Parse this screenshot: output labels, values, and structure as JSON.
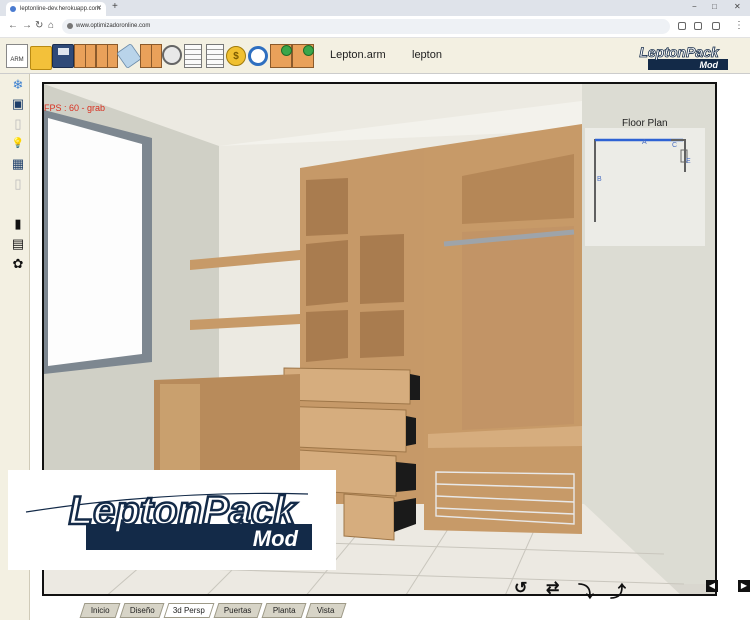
{
  "browser": {
    "tab_title": "leptonline-dev.herokuapp.com",
    "new_tab": "+",
    "url": "www.optimizadoronline.com",
    "win_minimize": "−",
    "win_maximize": "□",
    "win_close": "✕"
  },
  "toolbar": {
    "arm_label": "Lepton.arm",
    "user_label": "lepton",
    "new_doc_text": "ARM",
    "coin_text": "$",
    "icons": [
      "arm-doc-icon",
      "open-folder-icon",
      "save-disk-icon",
      "cabinet-icon",
      "cabinet-door-icon",
      "eraser-icon",
      "rotate-view-icon",
      "cabinet-frame-icon",
      "report-icon",
      "list-icon",
      "price-coin-icon",
      "refresh-icon",
      "cabinet-settings-icon",
      "cabinet-green-icon"
    ]
  },
  "logo": {
    "line1": "LeptonPack",
    "line2": "Mod"
  },
  "sidebar": {
    "items": [
      {
        "name": "3d-cube-icon",
        "glyph": "❄"
      },
      {
        "name": "hd-screen-icon",
        "glyph": "▣"
      },
      {
        "name": "fridge-icon",
        "glyph": "▯"
      },
      {
        "name": "lightbulb-icon",
        "glyph": "💡"
      },
      {
        "name": "window-icon",
        "glyph": "▦"
      },
      {
        "name": "door-light-icon",
        "glyph": "▯"
      },
      {
        "name": "door-dark-icon",
        "glyph": "▮"
      },
      {
        "name": "film-icon",
        "glyph": "▤"
      },
      {
        "name": "plant-icon",
        "glyph": "✿"
      }
    ]
  },
  "viewport": {
    "fps_text": "FPS : 60 - grab",
    "floor_plan_title": "Floor Plan",
    "floor_plan_labels": {
      "a": "A",
      "b": "B",
      "c": "C",
      "e": "E"
    }
  },
  "view_controls": {
    "undo": "↺",
    "swap": "⇄",
    "down": "⤵",
    "up": "⤴",
    "prev": "◀",
    "next": "▶"
  },
  "tabs": [
    {
      "label": "Inicio",
      "active": false
    },
    {
      "label": "Diseño",
      "active": false
    },
    {
      "label": "3d Persp",
      "active": true
    },
    {
      "label": "Puertas",
      "active": false
    },
    {
      "label": "Planta",
      "active": false
    },
    {
      "label": "Vista",
      "active": false
    }
  ]
}
